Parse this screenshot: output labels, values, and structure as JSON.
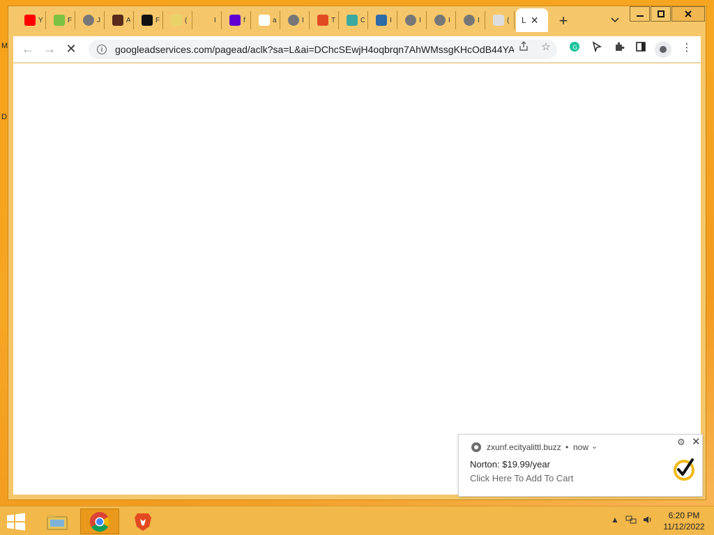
{
  "desktop": {
    "edge_glyphs": [
      "M",
      "D"
    ]
  },
  "browser": {
    "tabs": [
      {
        "icon": "youtube-icon",
        "char": "Y",
        "color": "#ff0000"
      },
      {
        "icon": "green-circle-icon",
        "char": "F",
        "color": "#7cc242"
      },
      {
        "icon": "globe-icon",
        "char": "J",
        "color": "#777777"
      },
      {
        "icon": "fnaf-icon",
        "char": "A",
        "color": "#5a2a1a"
      },
      {
        "icon": "black-star-icon",
        "char": "F",
        "color": "#111111"
      },
      {
        "icon": "m-icon",
        "char": "(",
        "color": "#e8d36a"
      },
      {
        "icon": "blank-icon",
        "char": "I",
        "color": "#f5c76a"
      },
      {
        "icon": "yahoo-icon",
        "char": "f",
        "color": "#6001d2"
      },
      {
        "icon": "google-icon",
        "char": "a",
        "color": "#ffffff"
      },
      {
        "icon": "globe-icon",
        "char": "I",
        "color": "#777777"
      },
      {
        "icon": "mail-icon",
        "char": "T",
        "color": "#e14b22"
      },
      {
        "icon": "teal-icon",
        "char": "C",
        "color": "#3ca9a0"
      },
      {
        "icon": "fs-icon",
        "char": "I",
        "color": "#2d6aa8"
      },
      {
        "icon": "globe-icon",
        "char": "I",
        "color": "#777777"
      },
      {
        "icon": "globe-icon",
        "char": "I",
        "color": "#777777"
      },
      {
        "icon": "globe-icon",
        "char": "I",
        "color": "#777777"
      },
      {
        "icon": "loading-icon",
        "char": "(",
        "color": "#dddddd"
      }
    ],
    "active_tab": {
      "char": "L"
    },
    "address": "googleadservices.com/pagead/aclk?sa=L&ai=DChcSEwjH4oqbrqn7AhWMssgKHcOdB44YA..."
  },
  "notification": {
    "source": "zxunf.ecityalittl.buzz",
    "time": "now",
    "title": "Norton: $19.99/year",
    "body": "Click Here To Add To Cart"
  },
  "taskbar": {
    "apps": [
      "file-explorer-icon",
      "chrome-icon",
      "brave-icon"
    ],
    "time": "6:20 PM",
    "date": "11/12/2022"
  }
}
